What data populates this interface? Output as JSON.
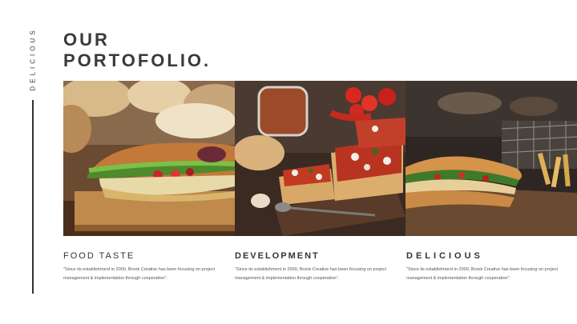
{
  "side_label": "DELICIOUS",
  "title": {
    "line1": "OUR",
    "line2": "PORTOFOLIO."
  },
  "columns": [
    {
      "heading": "FOOD TASTE",
      "body": "\"Since its establishment in 2000, Brook Creative has been focusing on project management & implementation through cooperation\"."
    },
    {
      "heading": "DEVELOPMENT",
      "body": "\"Since its establishment in 2000, Brook Creative has been focusing on project management & implementation through cooperation\"."
    },
    {
      "heading": "DELICIOUS",
      "body": "\"Since its establishment in 2000, Brook Creative has been focusing on project management & implementation through cooperation\"."
    }
  ]
}
